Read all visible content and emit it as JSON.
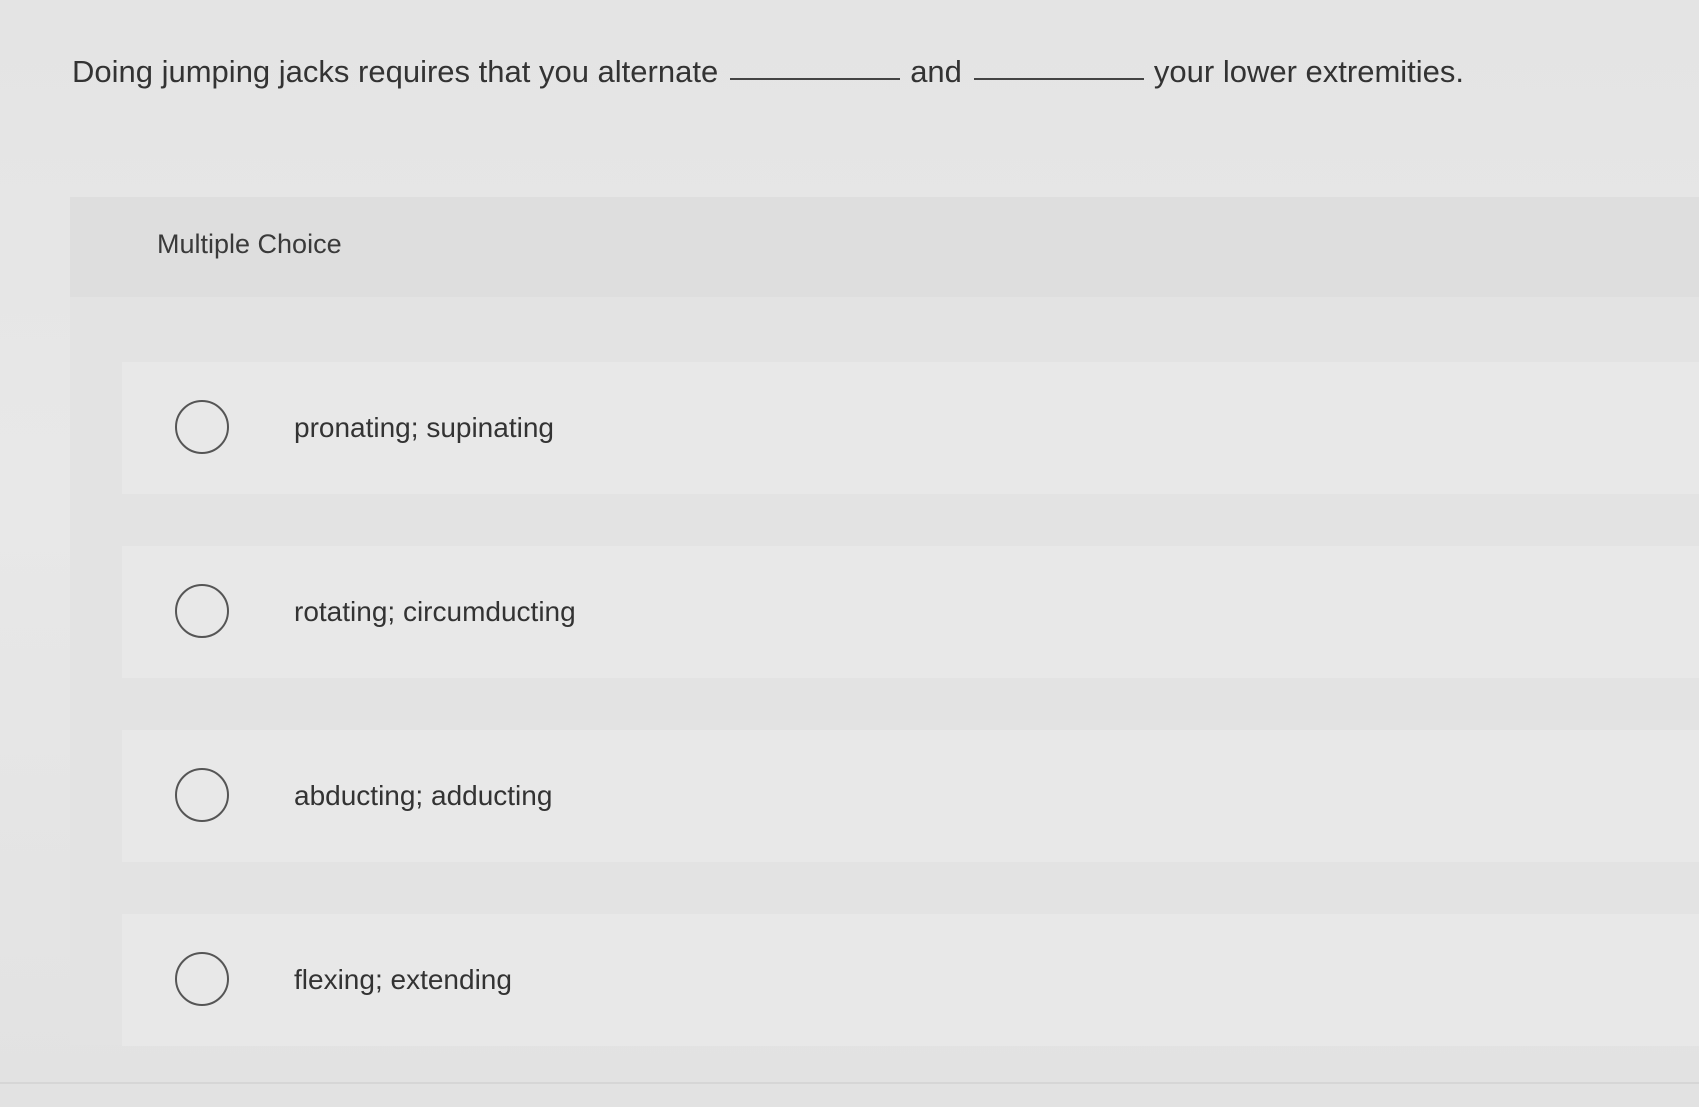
{
  "question": {
    "part1": "Doing jumping jacks requires that you alternate",
    "part2": "and",
    "part3": "your lower extremities."
  },
  "panel": {
    "type_label": "Multiple Choice"
  },
  "options": [
    {
      "label": "pronating; supinating",
      "icon": "radio-unselected"
    },
    {
      "label": "rotating; circumducting",
      "icon": "radio-unselected"
    },
    {
      "label": "abducting; adducting",
      "icon": "radio-unselected"
    },
    {
      "label": "flexing; extending",
      "icon": "radio-unselected"
    }
  ]
}
